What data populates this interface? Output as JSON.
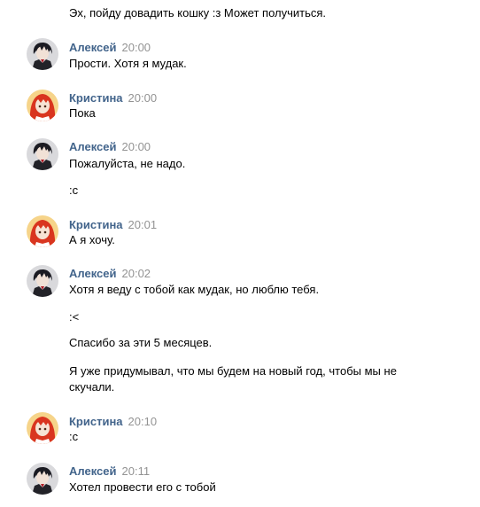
{
  "messages": [
    {
      "lines": [
        "Эх, пойду довадить кошку :з Может получиться."
      ]
    },
    {
      "author": "Алексей",
      "time": "20:00",
      "avatar": "aleksey",
      "lines": [
        "Прости. Хотя я мудак."
      ]
    },
    {
      "author": "Кристина",
      "time": "20:00",
      "avatar": "kristina",
      "lines": [
        "Пока"
      ]
    },
    {
      "author": "Алексей",
      "time": "20:00",
      "avatar": "aleksey",
      "lines": [
        "Пожалуйста, не надо.",
        ":c"
      ]
    },
    {
      "author": "Кристина",
      "time": "20:01",
      "avatar": "kristina",
      "lines": [
        "А я хочу."
      ]
    },
    {
      "author": "Алексей",
      "time": "20:02",
      "avatar": "aleksey",
      "lines": [
        "Хотя я веду с тобой как мудак, но люблю тебя.",
        ":<",
        "Спасибо за эти 5 месяцев.",
        "Я уже придумывал, что мы будем на новый год, чтобы мы не",
        "скучали."
      ]
    },
    {
      "author": "Кристина",
      "time": "20:10",
      "avatar": "kristina",
      "lines": [
        ":c"
      ]
    },
    {
      "author": "Алексей",
      "time": "20:11",
      "avatar": "aleksey",
      "lines": [
        "Хотел провести его с тобой"
      ]
    }
  ],
  "colors": {
    "author_name": "#42648b",
    "timestamp": "#939393",
    "text": "#000000",
    "background": "#ffffff"
  },
  "icons": {
    "aleksey": "dark-anime-boy-avatar-icon",
    "kristina": "red-haired-anime-girl-avatar-icon"
  }
}
